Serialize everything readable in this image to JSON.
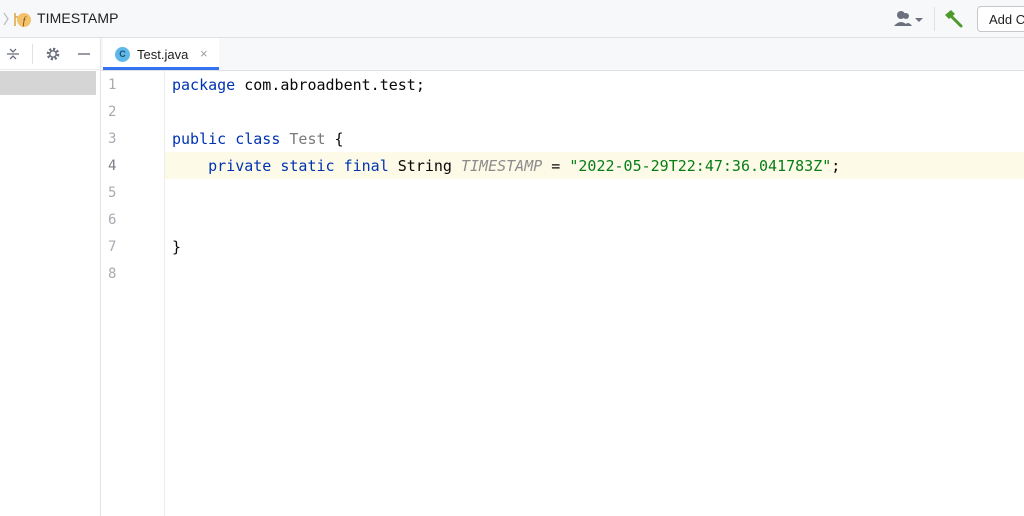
{
  "navbar": {
    "file_name": "TIMESTAMP",
    "add_configuration_label": "Add Configuration..."
  },
  "icons": {
    "breadcrumb_chevron": "chevron-right-icon",
    "file_type": "java-field-f-icon",
    "user": "user-dropdown-icon",
    "build": "hammer-build-icon",
    "collapse_all": "collapse-all-icon",
    "settings": "gear-icon",
    "hide": "minus-icon"
  },
  "tab": {
    "icon_letter": "C",
    "label": "Test.java",
    "close_glyph": "×"
  },
  "editor": {
    "line_numbers": [
      "1",
      "2",
      "3",
      "4",
      "5",
      "6",
      "7",
      "8"
    ],
    "current_line": 4,
    "code": {
      "l1_kw": "package",
      "l1_rest": " com.abroadbent.test;",
      "l3_kw1": "public",
      "l3_kw2": " class",
      "l3_name": " Test",
      "l3_brace": " {",
      "l4_indent": "    ",
      "l4_kw1": "private",
      "l4_kw2": " static",
      "l4_kw3": " final",
      "l4_type": " String ",
      "l4_const": "TIMESTAMP",
      "l4_eq": " = ",
      "l4_str": "\"2022-05-29T22:47:36.041783Z\"",
      "l4_semi": ";",
      "l7_brace": "}"
    }
  },
  "colors": {
    "keyword": "#0033b3",
    "string": "#067d17",
    "constant": "#8c8c8c",
    "accent": "#3574f0",
    "caret_row": "#fdfbe8"
  }
}
